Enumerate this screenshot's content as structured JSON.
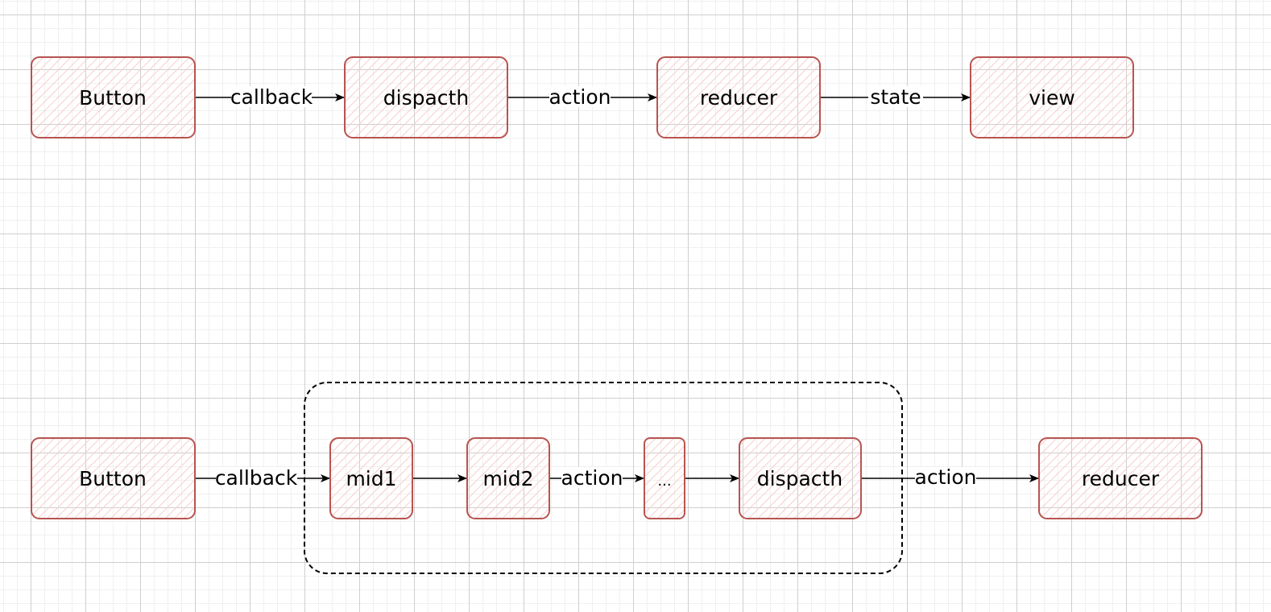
{
  "diagram": {
    "colors": {
      "node_stroke": "#b85450",
      "node_fill_hatch": "#f8cecc",
      "edge": "#000000",
      "group_stroke": "#000000"
    },
    "top_flow": {
      "nodes": [
        {
          "id": "button",
          "label": "Button"
        },
        {
          "id": "dispatch",
          "label": "dispacth"
        },
        {
          "id": "reducer",
          "label": "reducer"
        },
        {
          "id": "view",
          "label": "view"
        }
      ],
      "edges": [
        {
          "from": "button",
          "to": "dispatch",
          "label": "callback"
        },
        {
          "from": "dispatch",
          "to": "reducer",
          "label": "action"
        },
        {
          "from": "reducer",
          "to": "view",
          "label": "state"
        }
      ]
    },
    "bottom_flow": {
      "nodes": [
        {
          "id": "button",
          "label": "Button"
        },
        {
          "id": "mid1",
          "label": "mid1"
        },
        {
          "id": "mid2",
          "label": "mid2"
        },
        {
          "id": "ellipsis",
          "label": "..."
        },
        {
          "id": "dispatch",
          "label": "dispacth"
        },
        {
          "id": "reducer",
          "label": "reducer"
        }
      ],
      "edges": [
        {
          "from": "button",
          "to": "mid1",
          "label": "callback"
        },
        {
          "from": "mid1",
          "to": "mid2",
          "label": ""
        },
        {
          "from": "mid2",
          "to": "ellipsis",
          "label": "action"
        },
        {
          "from": "ellipsis",
          "to": "dispatch",
          "label": ""
        },
        {
          "from": "dispatch",
          "to": "reducer",
          "label": "action"
        }
      ],
      "group": {
        "id": "middleware-group",
        "label": ""
      }
    }
  }
}
